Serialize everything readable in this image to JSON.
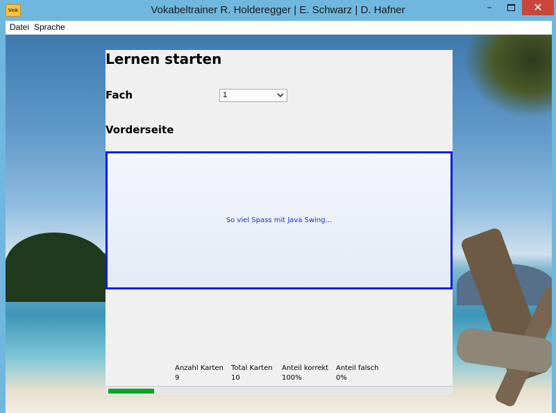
{
  "window": {
    "title": "Vokabeltrainer R. Holderegger | E. Schwarz | D. Hafner",
    "app_icon_text": "Vok",
    "minimize_symbol": "–",
    "close_symbol": "✕"
  },
  "menu": {
    "items": [
      {
        "label": "Datei"
      },
      {
        "label": "Sprache"
      }
    ]
  },
  "main": {
    "heading": "Lernen starten",
    "fach_label": "Fach",
    "fach_value": "1",
    "vorderseite_label": "Vorderseite",
    "card_text": "So viel Spass mit Java Swing..."
  },
  "stats": {
    "columns": [
      {
        "label": "Anzahl Karten",
        "value": "9"
      },
      {
        "label": "Total Karten",
        "value": "10"
      },
      {
        "label": "Anteil korrekt",
        "value": "100%"
      },
      {
        "label": "Anteil falsch",
        "value": "0%"
      }
    ]
  },
  "progress": {
    "fraction": 0.135
  },
  "colors": {
    "titlebar": "#6fb7de",
    "close_button": "#c7473b",
    "card_border": "#0a1ee6",
    "card_text": "#1a2ccf",
    "progress_fill": "#09a626"
  }
}
